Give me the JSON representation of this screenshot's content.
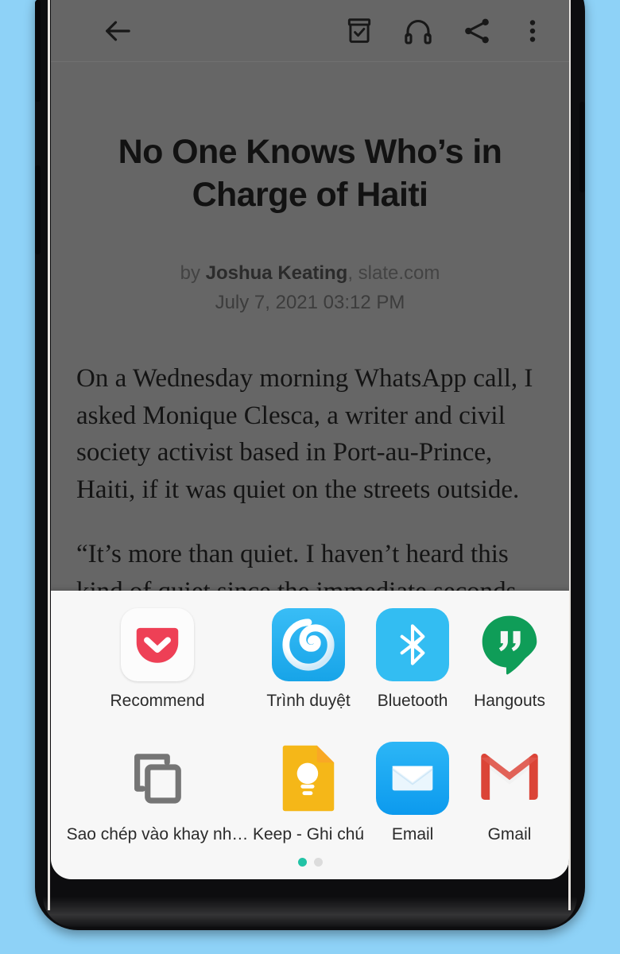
{
  "background_color": "#8ED2F7",
  "device": {
    "name": "android-phone",
    "frame_color": "#0d0d0f",
    "buttons": [
      "volume-up",
      "volume-down",
      "power"
    ]
  },
  "reader": {
    "dim_overlay_color": "#666666",
    "toolbar": {
      "back_label": "Back",
      "icons": [
        {
          "name": "back-icon",
          "label": "Back"
        },
        {
          "name": "archive-icon",
          "label": "Archive"
        },
        {
          "name": "headphones-icon",
          "label": "Listen"
        },
        {
          "name": "share-icon",
          "label": "Share"
        },
        {
          "name": "overflow-menu-icon",
          "label": "More options"
        }
      ]
    },
    "article": {
      "title": "No One Knows Who’s in Charge of Haiti",
      "byline_prefix": "by ",
      "author": "Joshua Keating",
      "source": ", slate.com",
      "date": "July 7, 2021 03:12 PM",
      "paragraphs": [
        "On a Wednesday morning WhatsApp call, I asked Monique Clesca, a writer and civil society activist based in Port-au-Prince, Haiti, if it was quiet on the streets outside.",
        "“It’s more than quiet. I haven’t heard this kind of quiet since the immediate seconds"
      ]
    }
  },
  "share_sheet": {
    "background_color": "#F7F7F7",
    "items": [
      {
        "label": "Recommend",
        "icon": "pocket-icon",
        "color": "#EE4056"
      },
      {
        "label": "Trình duyệt",
        "icon": "browser-icon",
        "color": "#29B2F2"
      },
      {
        "label": "Bluetooth",
        "icon": "bluetooth-icon",
        "color": "#33BDF2"
      },
      {
        "label": "Hangouts",
        "icon": "hangouts-icon",
        "color": "#0F9D58"
      },
      {
        "label": "Sao chép vào khay nh…",
        "icon": "copy-icon",
        "color": "#757575"
      },
      {
        "label": "Keep - Ghi chú",
        "icon": "keep-icon",
        "color": "#F5B718"
      },
      {
        "label": "Email",
        "icon": "email-icon",
        "color": "#1BA6F0"
      },
      {
        "label": "Gmail",
        "icon": "gmail-icon",
        "color": "#DB4437"
      }
    ],
    "pagination": {
      "pages": 2,
      "active_index": 0,
      "active_color": "#22C3A6",
      "inactive_color": "#DCDCDC"
    }
  }
}
